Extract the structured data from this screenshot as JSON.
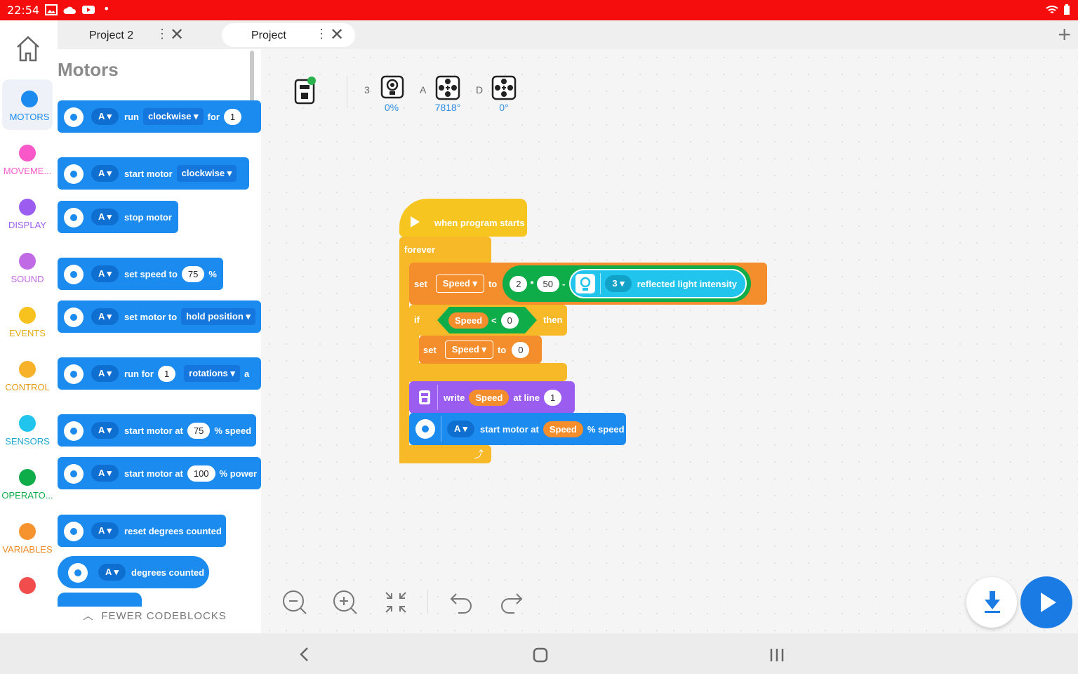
{
  "status": {
    "time": "22:54"
  },
  "tabs": [
    {
      "label": "Project 2",
      "active": false
    },
    {
      "label": "Project",
      "active": true
    }
  ],
  "categories": [
    {
      "label": "MOTORS",
      "color": "#1b8bef",
      "active": true
    },
    {
      "label": "MOVEME...",
      "color": "#f858c8"
    },
    {
      "label": "DISPLAY",
      "color": "#9b5cf0"
    },
    {
      "label": "SOUND",
      "color": "#c06ae6"
    },
    {
      "label": "EVENTS",
      "color": "#f7c21e"
    },
    {
      "label": "CONTROL",
      "color": "#f7b22a"
    },
    {
      "label": "SENSORS",
      "color": "#20c4ec"
    },
    {
      "label": "OPERATO...",
      "color": "#0fac4a"
    },
    {
      "label": "VARIABLES",
      "color": "#f7932e"
    },
    {
      "label": "",
      "color": "#f24d4d"
    }
  ],
  "palette": {
    "title": "Motors",
    "blocks": [
      {
        "port": "A",
        "t1": "run",
        "drop": "clockwise",
        "t2": "for",
        "val": "1"
      },
      {
        "port": "A",
        "t1": "start motor",
        "drop": "clockwise"
      },
      {
        "port": "A",
        "t1": "stop motor"
      },
      {
        "port": "A",
        "t1": "set speed to",
        "val": "75",
        "t2": "%"
      },
      {
        "port": "A",
        "t1": "set motor to",
        "drop": "hold position"
      },
      {
        "port": "A",
        "t1": "run for",
        "val": "1",
        "drop": "rotations",
        "t2": "a"
      },
      {
        "port": "A",
        "t1": "start motor at",
        "val": "75",
        "t2": "% speed"
      },
      {
        "port": "A",
        "t1": "start motor at",
        "val": "100",
        "t2": "% power"
      },
      {
        "port": "A",
        "t1": "reset degrees counted"
      },
      {
        "port": "A",
        "t1": "degrees counted"
      }
    ],
    "fewer": "FEWER CODEBLOCKS"
  },
  "ports": [
    {
      "port": "3",
      "value": "0%"
    },
    {
      "port": "A",
      "value": "7818°"
    },
    {
      "port": "D",
      "value": "0°"
    }
  ],
  "program": {
    "hat": "when program starts",
    "forever": "forever",
    "set1": {
      "set": "set",
      "var": "Speed",
      "to": "to",
      "a": "2",
      "op": "*",
      "b": "50",
      "minus": "-",
      "port": "3",
      "sensor": "reflected light intensity"
    },
    "if": {
      "if": "if",
      "var": "Speed",
      "op": "<",
      "val": "0",
      "then": "then"
    },
    "set2": {
      "set": "set",
      "var": "Speed",
      "to": "to",
      "val": "0"
    },
    "write": {
      "write": "write",
      "var": "Speed",
      "atline": "at line",
      "line": "1"
    },
    "motor": {
      "port": "A",
      "t1": "start motor at",
      "var": "Speed",
      "t2": "% speed"
    }
  }
}
